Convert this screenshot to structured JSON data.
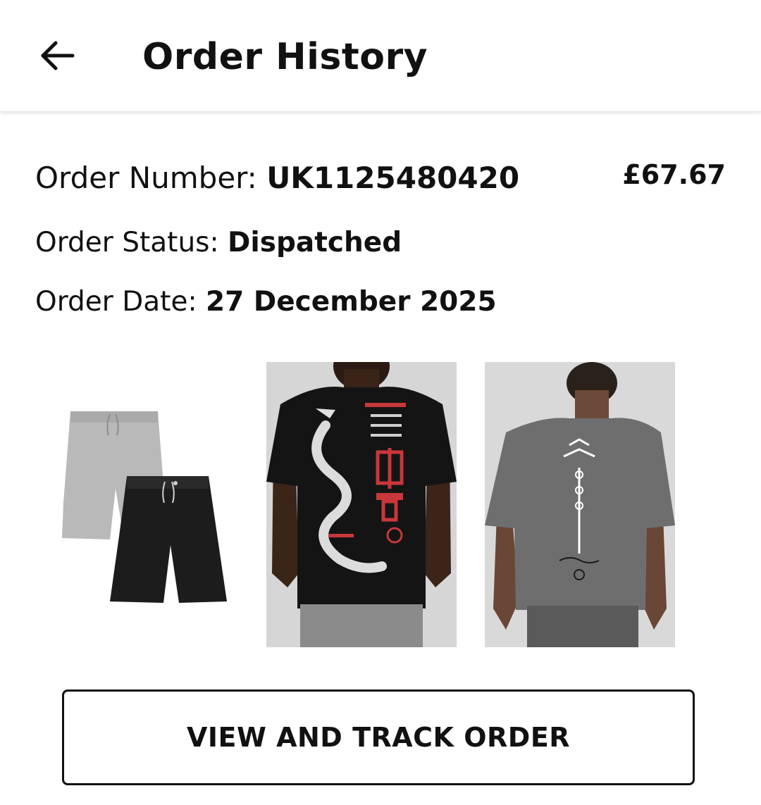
{
  "header": {
    "title": "Order History",
    "back_icon": "arrow-left-icon"
  },
  "order": {
    "number_label": "Order Number: ",
    "number_value": "UK1125480420",
    "total": "£67.67",
    "status_label": "Order Status: ",
    "status_value": "Dispatched",
    "date_label": "Order Date: ",
    "date_value": "27 December 2025",
    "items": [
      {
        "name": "shorts-two-pack-image"
      },
      {
        "name": "black-tshirt-dragon-print-image"
      },
      {
        "name": "grey-tshirt-print-image"
      }
    ]
  },
  "actions": {
    "track_label": "VIEW AND TRACK ORDER"
  },
  "colors": {
    "text": "#111111",
    "background": "#ffffff",
    "accent_red": "#c8373a"
  }
}
